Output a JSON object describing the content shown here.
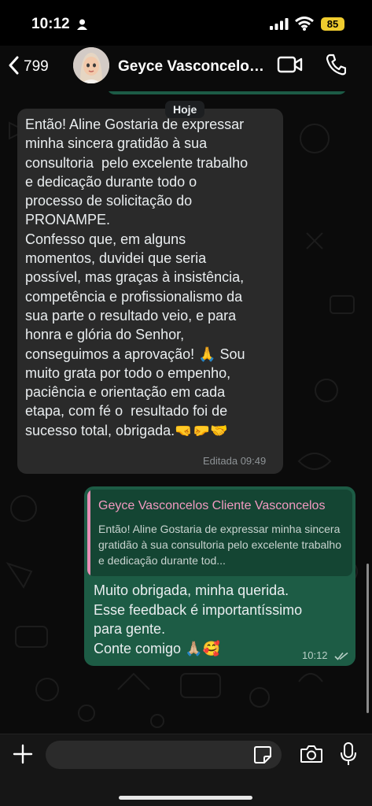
{
  "status_bar": {
    "time": "10:12",
    "battery": "85"
  },
  "header": {
    "back_count": "799",
    "contact_name": "Geyce Vasconcelos Cliente Vasconcelos"
  },
  "chat": {
    "date_chip": "Hoje",
    "incoming": {
      "text": "Então! Aline Gostaria de expressar\nminha sincera gratidão à sua\nconsultoria  pelo excelente trabalho\ne dedicação durante todo o\nprocesso de solicitação do\nPRONAMPE.\nConfesso que, em alguns\nmomentos, duvidei que seria\npossível, mas graças à insistência,\ncompetência e profissionalismo da\nsua parte o resultado veio, e para\nhonra e glória do Senhor,\nconseguimos a aprovação! 🙏 Sou\nmuito grata por todo o empenho,\npaciência e orientação em cada\netapa, com fé o  resultado foi de\nsucesso total, obrigada.🤜🤛🤝",
      "meta": "Editada 09:49"
    },
    "outgoing": {
      "quoted_name": "Geyce Vasconcelos Cliente Vasconcelos",
      "quoted_text": "Então! Aline Gostaria de expressar minha sincera gratidão à sua consultoria  pelo excelente trabalho e dedicação durante tod...",
      "text": "Muito obrigada, minha querida.\nEsse feedback é importantíssimo\npara gente.\nConte comigo 🙏🏼🥰",
      "time": "10:12"
    }
  },
  "input": {
    "placeholder": ""
  },
  "colors": {
    "incoming_bubble": "#2a2a2a",
    "outgoing_bubble": "#1d5c45",
    "quote_accent": "#e98fb6"
  }
}
